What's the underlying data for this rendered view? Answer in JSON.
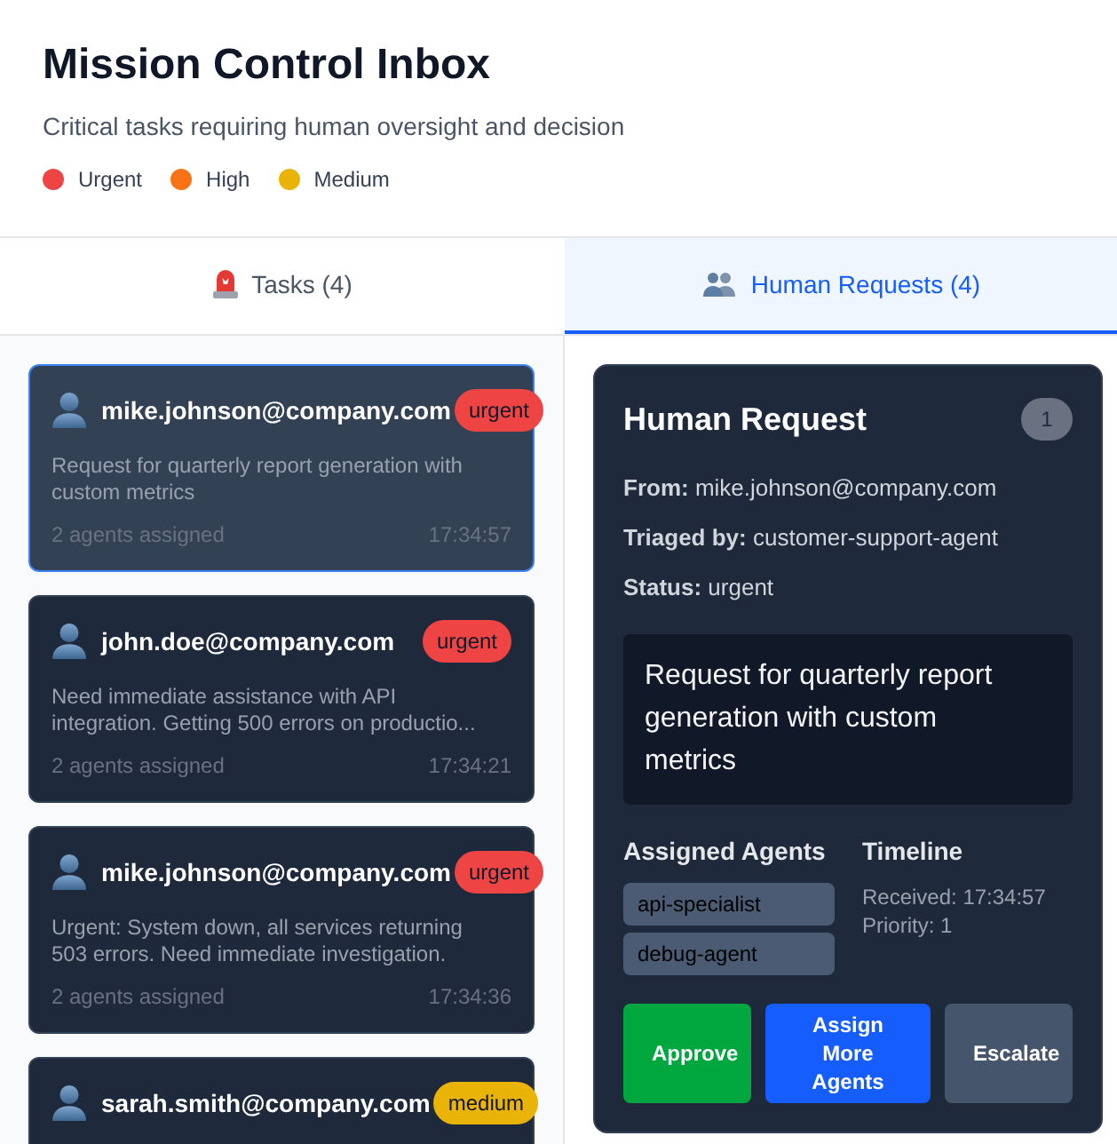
{
  "header": {
    "title": "Mission Control Inbox",
    "subtitle": "Critical tasks requiring human oversight and decision",
    "legend": [
      {
        "label": "Urgent",
        "color": "#ef4444"
      },
      {
        "label": "High",
        "color": "#f97316"
      },
      {
        "label": "Medium",
        "color": "#eab308"
      }
    ]
  },
  "tabs": [
    {
      "label": "Tasks (4)",
      "selected": false
    },
    {
      "label": "Human Requests (4)",
      "selected": true
    }
  ],
  "tasks": [
    {
      "email": "mike.johnson@company.com",
      "priority": "urgent",
      "color": "#ef4444",
      "description": "Request for quarterly report generation with custom metrics",
      "agents": "2 agents assigned",
      "time": "17:34:57",
      "selected": true
    },
    {
      "email": "john.doe@company.com",
      "priority": "urgent",
      "color": "#ef4444",
      "description": "Need immediate assistance with API integration. Getting 500 errors on productio...",
      "agents": "2 agents assigned",
      "time": "17:34:21",
      "selected": false
    },
    {
      "email": "mike.johnson@company.com",
      "priority": "urgent",
      "color": "#ef4444",
      "description": "Urgent: System down, all services returning 503 errors. Need immediate investigation.",
      "agents": "2 agents assigned",
      "time": "17:34:36",
      "selected": false
    },
    {
      "email": "sarah.smith@company.com",
      "priority": "medium",
      "color": "#eab308",
      "selected": false
    }
  ],
  "detail": {
    "title": "Human Request",
    "count": "1",
    "fields": [
      {
        "label": "From:",
        "value": "mike.johnson@company.com"
      },
      {
        "label": "Triaged by:",
        "value": "customer-support-agent"
      },
      {
        "label": "Status:",
        "value": "urgent"
      }
    ],
    "message": "Request for quarterly report generation with custom metrics",
    "agents_heading": "Assigned Agents",
    "agents": [
      "api-specialist",
      "debug-agent"
    ],
    "timeline_heading": "Timeline",
    "timeline": [
      "Received: 17:34:57",
      "Priority: 1"
    ],
    "actions": [
      {
        "label": "Approve",
        "kind": "approve"
      },
      {
        "label": "Assign More Agents",
        "kind": "assign"
      },
      {
        "label": "Escalate",
        "kind": "escalate"
      }
    ]
  }
}
